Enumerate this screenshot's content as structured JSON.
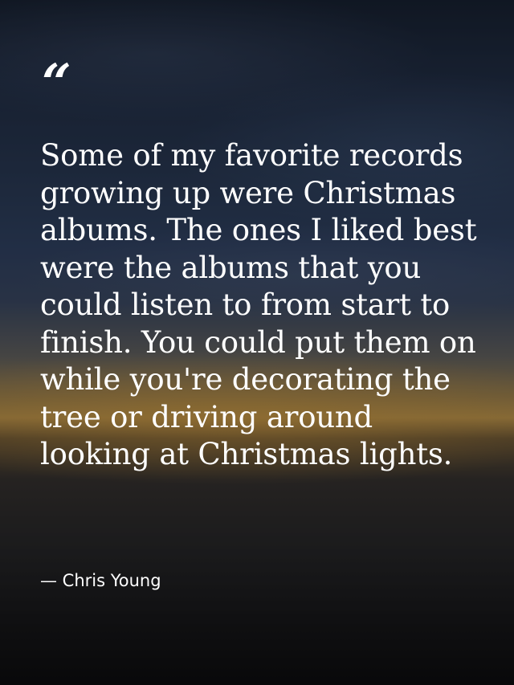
{
  "quote": {
    "mark": "“",
    "text": "Some of my favorite records growing up were Christmas albums. The ones I liked best were the albums that you could listen to from start to finish. You could put them on while you're decorating the tree or driving around looking at Christmas lights.",
    "author": "— Chris Young"
  },
  "colors": {
    "text": "#ffffff",
    "sky_top": "#1a2436",
    "horizon_glow": "#caa054",
    "ground": "#0e0e10"
  }
}
